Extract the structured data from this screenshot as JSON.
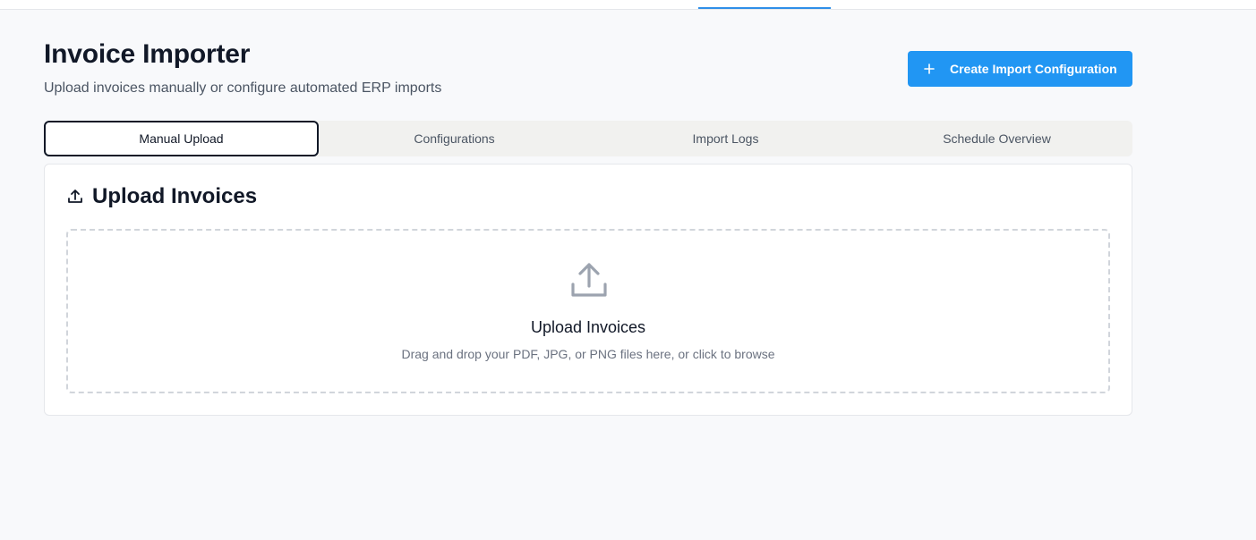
{
  "header": {
    "title": "Invoice Importer",
    "subtitle": "Upload invoices manually or configure automated ERP imports",
    "create_button_label": "Create Import Configuration"
  },
  "tabs": [
    {
      "label": "Manual Upload",
      "active": true
    },
    {
      "label": "Configurations",
      "active": false
    },
    {
      "label": "Import Logs",
      "active": false
    },
    {
      "label": "Schedule Overview",
      "active": false
    }
  ],
  "upload_card": {
    "title": "Upload Invoices",
    "dropzone": {
      "title": "Upload Invoices",
      "hint": "Drag and drop your PDF, JPG, or PNG files here, or click to browse"
    }
  },
  "icons": {
    "create": "plus-icon",
    "card_header": "upload-icon",
    "dropzone": "upload-icon"
  },
  "colors": {
    "accent": "#2196f3",
    "background": "#f8f9fb",
    "text_primary": "#111827",
    "text_muted": "#6b7280"
  }
}
